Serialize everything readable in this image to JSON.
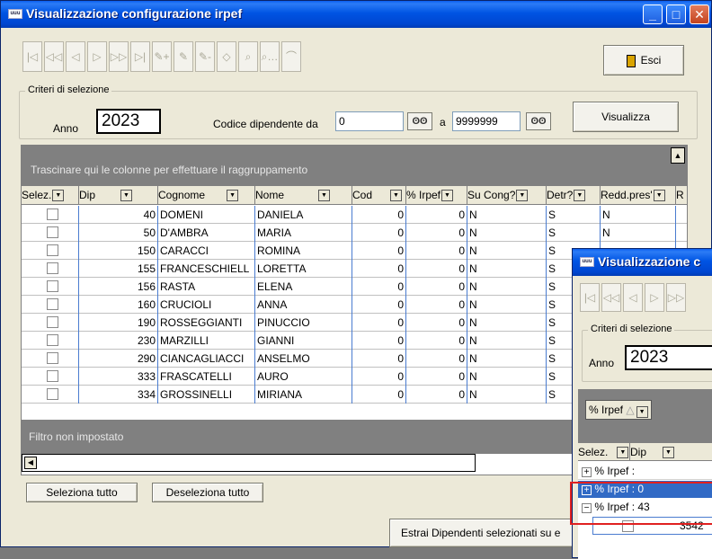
{
  "main_window": {
    "title": "Visualizzazione configurazione irpef",
    "app_icon_text": "uuu",
    "caption_buttons": {
      "minimize": "_",
      "maximize": "□",
      "close": "✕"
    },
    "toolbar": {
      "nav_icons": [
        "|◁",
        "◁◁",
        "◁",
        "▷",
        "▷▷",
        "▷|",
        "✎+",
        "✎",
        "✎-",
        "◇",
        "⌕",
        "⌕…",
        "⌒"
      ],
      "exit_label": "Esci"
    },
    "criteria": {
      "legend": "Criteri di selezione",
      "year_label": "Anno",
      "year_value": "2023",
      "employee_code_label": "Codice dipendente da",
      "from_value": "0",
      "to_label": "a",
      "to_value": "9999999",
      "binoculars_icon": "ʘʘ",
      "view_button": "Visualizza"
    },
    "grid": {
      "group_hint": "Trascinare qui le colonne per effettuare il raggruppamento",
      "columns": [
        "Selez.",
        "Dip",
        "Cognome",
        "Nome",
        "Cod",
        "% Irpef",
        "Su Cong?",
        "Detr?",
        "Redd.pres'",
        "R"
      ],
      "rows": [
        {
          "dip": "40",
          "cognome": "DOMENI",
          "nome": "DANIELA",
          "cod": "0",
          "irpef": "0",
          "cong": "N",
          "detr": "S",
          "redd": "N"
        },
        {
          "dip": "50",
          "cognome": "D'AMBRA",
          "nome": "MARIA",
          "cod": "0",
          "irpef": "0",
          "cong": "N",
          "detr": "S",
          "redd": "N"
        },
        {
          "dip": "150",
          "cognome": "CARACCI",
          "nome": "ROMINA",
          "cod": "0",
          "irpef": "0",
          "cong": "N",
          "detr": "S",
          "redd": ""
        },
        {
          "dip": "155",
          "cognome": "FRANCESCHIELL",
          "nome": "LORETTA",
          "cod": "0",
          "irpef": "0",
          "cong": "N",
          "detr": "S",
          "redd": ""
        },
        {
          "dip": "156",
          "cognome": "RASTA",
          "nome": "ELENA",
          "cod": "0",
          "irpef": "0",
          "cong": "N",
          "detr": "S",
          "redd": ""
        },
        {
          "dip": "160",
          "cognome": "CRUCIOLI",
          "nome": "ANNA",
          "cod": "0",
          "irpef": "0",
          "cong": "N",
          "detr": "S",
          "redd": ""
        },
        {
          "dip": "190",
          "cognome": "ROSSEGGIANTI",
          "nome": "PINUCCIO",
          "cod": "0",
          "irpef": "0",
          "cong": "N",
          "detr": "S",
          "redd": ""
        },
        {
          "dip": "230",
          "cognome": "MARZILLI",
          "nome": "GIANNI",
          "cod": "0",
          "irpef": "0",
          "cong": "N",
          "detr": "S",
          "redd": ""
        },
        {
          "dip": "290",
          "cognome": "CIANCAGLIACCI",
          "nome": "ANSELMO",
          "cod": "0",
          "irpef": "0",
          "cong": "N",
          "detr": "S",
          "redd": ""
        },
        {
          "dip": "333",
          "cognome": "FRASCATELLI",
          "nome": "AURO",
          "cod": "0",
          "irpef": "0",
          "cong": "N",
          "detr": "S",
          "redd": ""
        },
        {
          "dip": "334",
          "cognome": "GROSSINELLI",
          "nome": "MIRIANA",
          "cod": "0",
          "irpef": "0",
          "cong": "N",
          "detr": "S",
          "redd": ""
        }
      ],
      "filter_text": "Filtro non impostato"
    },
    "buttons": {
      "select_all": "Seleziona tutto",
      "deselect_all": "Deseleziona tutto",
      "extract": "Estrai Dipendenti selezionati su e"
    }
  },
  "second_window": {
    "title": "Visualizzazione c",
    "nav_icons": [
      "|◁",
      "◁◁",
      "◁",
      "▷",
      "▷▷"
    ],
    "legend": "Criteri di selezione",
    "year_label": "Anno",
    "year_value": "2023",
    "group_chip": "% Irpef",
    "columns": [
      "Selez.",
      "Dip"
    ],
    "groups": [
      {
        "toggle": "+",
        "label": "% Irpef :"
      },
      {
        "toggle": "+",
        "label": "% Irpef : 0"
      },
      {
        "toggle": "−",
        "label": "% Irpef : 43"
      }
    ],
    "child_row_dip": "3542"
  },
  "colors": {
    "title_blue": "#0054e3",
    "grid_border_blue": "#4a7cd0",
    "highlight_red": "#e02020",
    "selected_row": "#316ac5"
  }
}
